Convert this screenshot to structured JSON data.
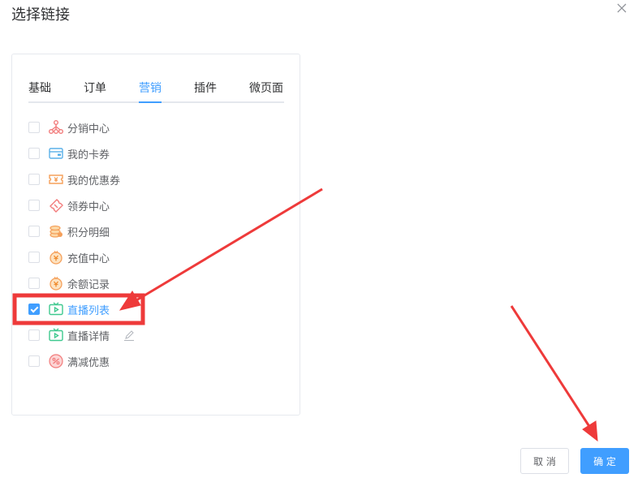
{
  "dialog": {
    "title": "选择链接"
  },
  "tabs": [
    {
      "label": "基础"
    },
    {
      "label": "订单"
    },
    {
      "label": "营销"
    },
    {
      "label": "插件"
    },
    {
      "label": "微页面"
    }
  ],
  "active_tab": "营销",
  "items": [
    {
      "label": "分销中心",
      "icon": "distribution-icon",
      "checked": false
    },
    {
      "label": "我的卡券",
      "icon": "card-icon",
      "checked": false
    },
    {
      "label": "我的优惠券",
      "icon": "coupon-icon",
      "checked": false
    },
    {
      "label": "领券中心",
      "icon": "ticket-icon",
      "checked": false
    },
    {
      "label": "积分明细",
      "icon": "coins-icon",
      "checked": false
    },
    {
      "label": "充值中心",
      "icon": "recharge-icon",
      "checked": false
    },
    {
      "label": "余额记录",
      "icon": "balance-icon",
      "checked": false
    },
    {
      "label": "直播列表",
      "icon": "live-tv-icon",
      "checked": true
    },
    {
      "label": "直播详情",
      "icon": "live-tv-icon",
      "checked": false
    },
    {
      "label": "满减优惠",
      "icon": "discount-icon",
      "checked": false
    }
  ],
  "footer": {
    "cancel_label": "取 消",
    "ok_label": "确 定"
  },
  "colors": {
    "accent": "#409eff",
    "annotation": "#ee3a3a"
  }
}
